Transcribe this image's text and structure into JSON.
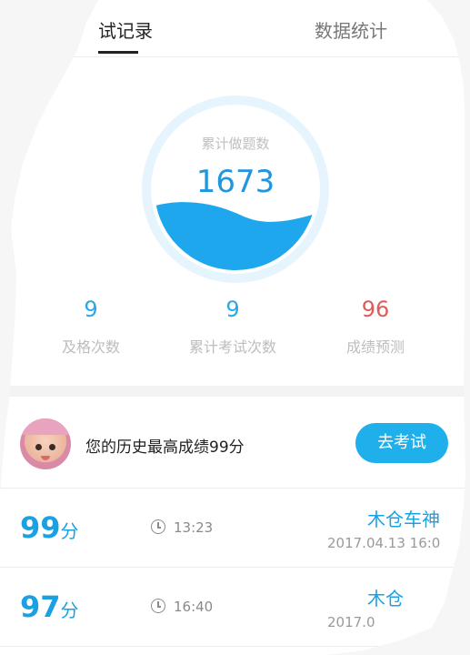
{
  "tabs": {
    "active_label": "试记录",
    "second_label": "数据统计"
  },
  "gauge": {
    "label": "累计做题数",
    "value": "1673",
    "fill_level": 0.4
  },
  "stats": [
    {
      "value": "9",
      "label": "及格次数",
      "color": "#28a8e6"
    },
    {
      "value": "9",
      "label": "累计考试次数",
      "color": "#28a8e6"
    },
    {
      "value": "96",
      "label": "成绩预测",
      "color": "#e05a5a"
    }
  ],
  "best": {
    "text": "您的历史最高成绩99分",
    "button_label": "去考试"
  },
  "records": [
    {
      "score": "99",
      "unit": "分",
      "time": "13:23",
      "name": "木仓车神",
      "date": "2017.04.13  16:0"
    },
    {
      "score": "97",
      "unit": "分",
      "time": "16:40",
      "name": "木仓",
      "date": "2017.0"
    }
  ],
  "colors": {
    "accent": "#1fb0ec",
    "score_blue": "#1ba0e2",
    "prediction_red": "#e05a5a"
  }
}
